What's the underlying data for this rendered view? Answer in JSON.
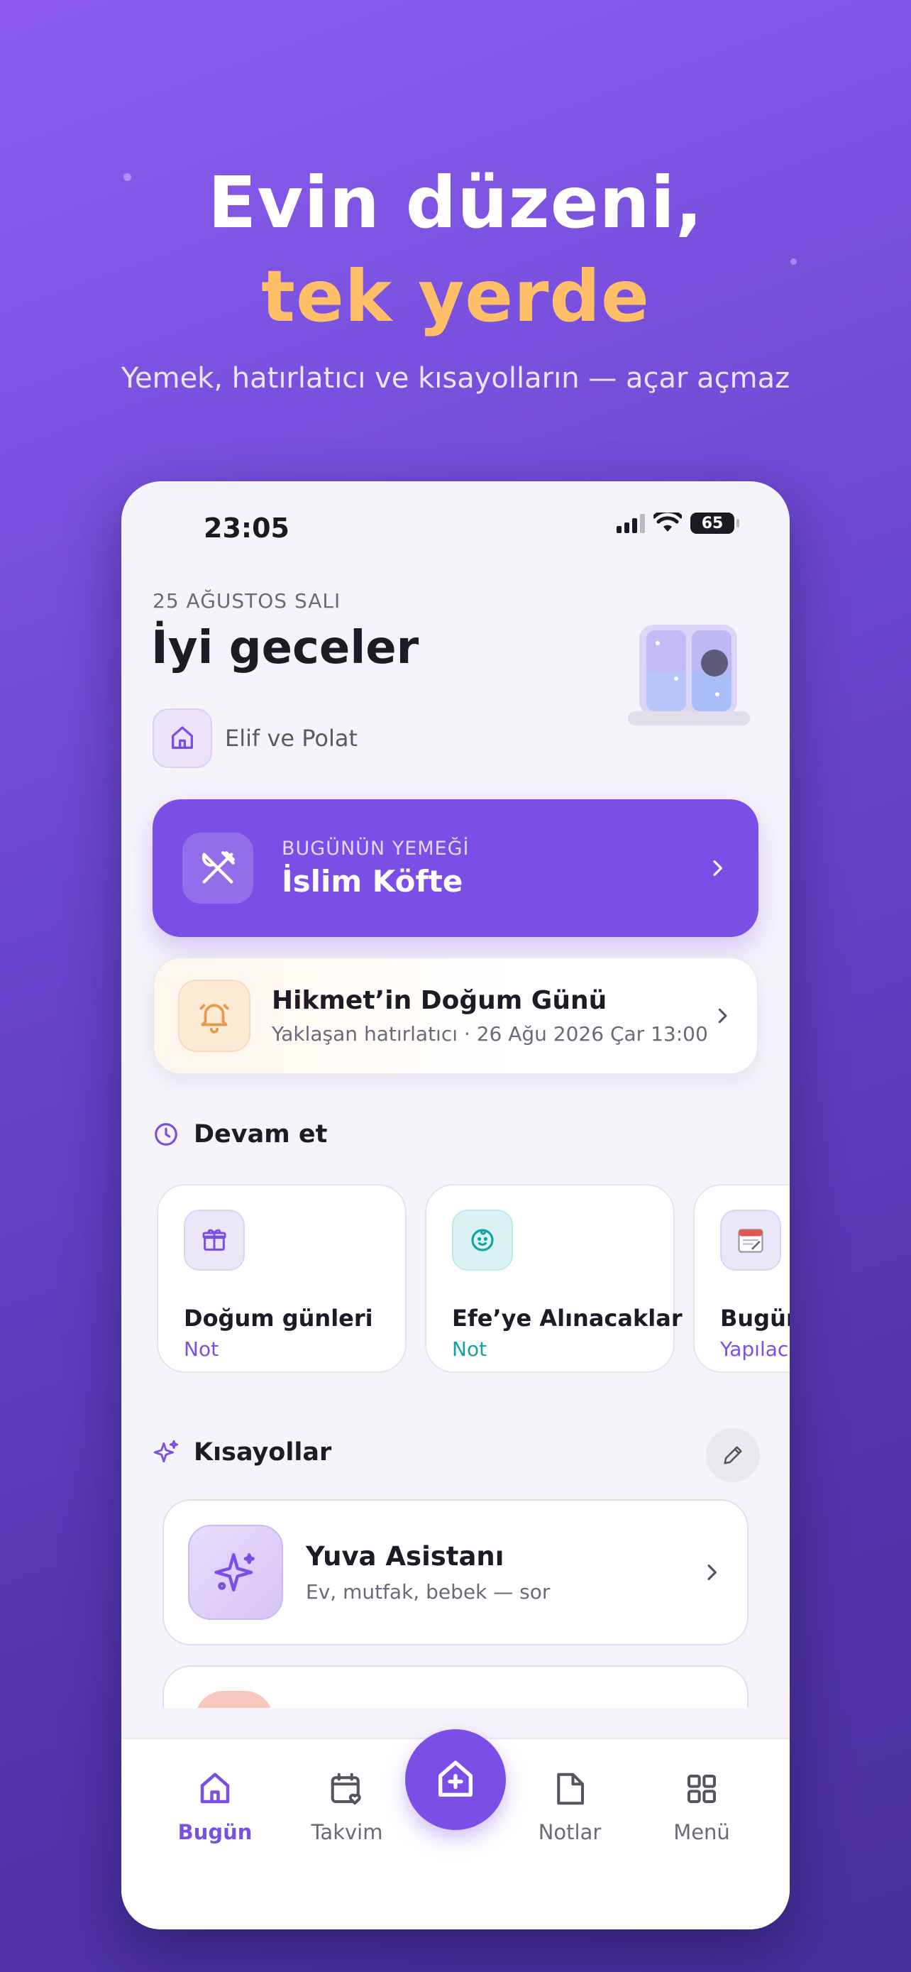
{
  "hero": {
    "line1": "Evin düzeni,",
    "line2": "tek yerde",
    "subtitle": "Yemek, hatırlatıcı ve kısayolların — açar açmaz"
  },
  "status_bar": {
    "time": "23:05",
    "battery": "65"
  },
  "header": {
    "date": "25 AĞUSTOS SALI",
    "greeting": "İyi geceler",
    "household_name": "Elif ve Polat"
  },
  "meal": {
    "label": "BUGÜNÜN YEMEĞİ",
    "name": "İslim Köfte"
  },
  "reminder": {
    "title": "Hikmet’in Doğum Günü",
    "subtitle": "Yaklaşan hatırlatıcı · 26 Ağu 2026 Çar 13:00"
  },
  "continue_section": {
    "title": "Devam et",
    "cards": [
      {
        "title": "Doğum günleri",
        "type": "Not",
        "icon": "gift-icon",
        "type_color": "#7b4fe6"
      },
      {
        "title": "Efe’ye Alınacaklar",
        "type": "Not",
        "icon": "baby-face-icon",
        "type_color": "#12a3a3"
      },
      {
        "title": "Bugün",
        "type": "Yapılaca",
        "icon": "calendar-note-icon",
        "type_color": "#7b4fe6"
      }
    ]
  },
  "shortcuts": {
    "title": "Kısayollar",
    "items": [
      {
        "title": "Yuva Asistanı",
        "subtitle": "Ev, mutfak, bebek — sor"
      }
    ]
  },
  "tabbar": {
    "tabs": [
      {
        "label": "Bugün"
      },
      {
        "label": "Takvim"
      },
      {
        "label": "Notlar"
      },
      {
        "label": "Menü"
      }
    ]
  },
  "colors": {
    "accent": "#7b4fe6",
    "hero_accent": "#ffbf69",
    "teal": "#12a3a3"
  }
}
